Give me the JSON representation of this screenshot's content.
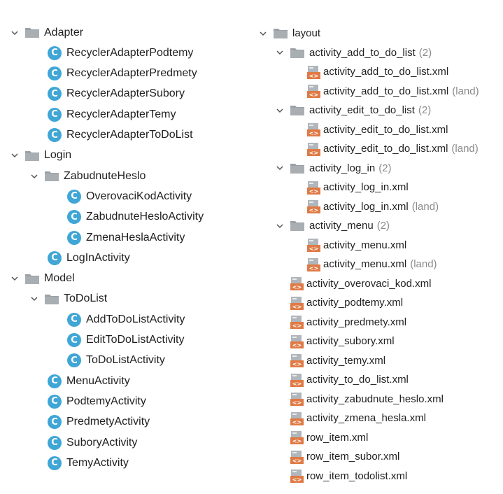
{
  "left_tree": [
    {
      "type": "folder",
      "label": "Adapter",
      "depth": 0,
      "expanded": true
    },
    {
      "type": "class",
      "label": "RecyclerAdapterPodtemy",
      "depth": 1
    },
    {
      "type": "class",
      "label": "RecyclerAdapterPredmety",
      "depth": 1
    },
    {
      "type": "class",
      "label": "RecyclerAdapterSubory",
      "depth": 1
    },
    {
      "type": "class",
      "label": "RecyclerAdapterTemy",
      "depth": 1
    },
    {
      "type": "class",
      "label": "RecyclerAdapterToDoList",
      "depth": 1
    },
    {
      "type": "folder",
      "label": "Login",
      "depth": 0,
      "expanded": true
    },
    {
      "type": "folder",
      "label": "ZabudnuteHeslo",
      "depth": 1,
      "expanded": true
    },
    {
      "type": "class",
      "label": "OverovaciKodActivity",
      "depth": 2
    },
    {
      "type": "class",
      "label": "ZabudnuteHesloActivity",
      "depth": 2
    },
    {
      "type": "class",
      "label": "ZmenaHeslaActivity",
      "depth": 2
    },
    {
      "type": "class",
      "label": "LogInActivity",
      "depth": 1
    },
    {
      "type": "folder",
      "label": "Model",
      "depth": 0,
      "expanded": true
    },
    {
      "type": "folder",
      "label": "ToDoList",
      "depth": 1,
      "expanded": true
    },
    {
      "type": "class",
      "label": "AddToDoListActivity",
      "depth": 2
    },
    {
      "type": "class",
      "label": "EditToDoListActivity",
      "depth": 2
    },
    {
      "type": "class",
      "label": "ToDoListActivity",
      "depth": 2
    },
    {
      "type": "class",
      "label": "MenuActivity",
      "depth": 1
    },
    {
      "type": "class",
      "label": "PodtemyActivity",
      "depth": 1
    },
    {
      "type": "class",
      "label": "PredmetyActivity",
      "depth": 1
    },
    {
      "type": "class",
      "label": "SuboryActivity",
      "depth": 1
    },
    {
      "type": "class",
      "label": "TemyActivity",
      "depth": 1
    }
  ],
  "right_tree": [
    {
      "type": "folder",
      "label": "layout",
      "depth": 0,
      "expanded": true
    },
    {
      "type": "folder",
      "label": "activity_add_to_do_list",
      "count": "(2)",
      "depth": 1,
      "expanded": true
    },
    {
      "type": "xml",
      "label": "activity_add_to_do_list.xml",
      "depth": 2
    },
    {
      "type": "xml",
      "label": "activity_add_to_do_list.xml",
      "qualifier": "(land)",
      "depth": 2
    },
    {
      "type": "folder",
      "label": "activity_edit_to_do_list",
      "count": "(2)",
      "depth": 1,
      "expanded": true
    },
    {
      "type": "xml",
      "label": "activity_edit_to_do_list.xml",
      "depth": 2
    },
    {
      "type": "xml",
      "label": "activity_edit_to_do_list.xml",
      "qualifier": "(land)",
      "depth": 2
    },
    {
      "type": "folder",
      "label": "activity_log_in",
      "count": "(2)",
      "depth": 1,
      "expanded": true
    },
    {
      "type": "xml",
      "label": "activity_log_in.xml",
      "depth": 2
    },
    {
      "type": "xml",
      "label": "activity_log_in.xml",
      "qualifier": "(land)",
      "depth": 2
    },
    {
      "type": "folder",
      "label": "activity_menu",
      "count": "(2)",
      "depth": 1,
      "expanded": true
    },
    {
      "type": "xml",
      "label": "activity_menu.xml",
      "depth": 2
    },
    {
      "type": "xml",
      "label": "activity_menu.xml",
      "qualifier": "(land)",
      "depth": 2
    },
    {
      "type": "xml",
      "label": "activity_overovaci_kod.xml",
      "depth": 1
    },
    {
      "type": "xml",
      "label": "activity_podtemy.xml",
      "depth": 1
    },
    {
      "type": "xml",
      "label": "activity_predmety.xml",
      "depth": 1
    },
    {
      "type": "xml",
      "label": "activity_subory.xml",
      "depth": 1
    },
    {
      "type": "xml",
      "label": "activity_temy.xml",
      "depth": 1
    },
    {
      "type": "xml",
      "label": "activity_to_do_list.xml",
      "depth": 1
    },
    {
      "type": "xml",
      "label": "activity_zabudnute_heslo.xml",
      "depth": 1
    },
    {
      "type": "xml",
      "label": "activity_zmena_hesla.xml",
      "depth": 1
    },
    {
      "type": "xml",
      "label": "row_item.xml",
      "depth": 1
    },
    {
      "type": "xml",
      "label": "row_item_subor.xml",
      "depth": 1
    },
    {
      "type": "xml",
      "label": "row_item_todolist.xml",
      "depth": 1
    }
  ],
  "icons": {
    "folder": "folder-icon",
    "class": "class-icon",
    "xml": "xml-layout-icon",
    "chevron": "chevron-down-icon"
  },
  "colors": {
    "class_icon": "#3fa6d6",
    "xml_icon": "#e07a45",
    "folder_icon": "#9aa0a6",
    "muted_text": "#8a8a8a"
  },
  "class_glyph": "C"
}
